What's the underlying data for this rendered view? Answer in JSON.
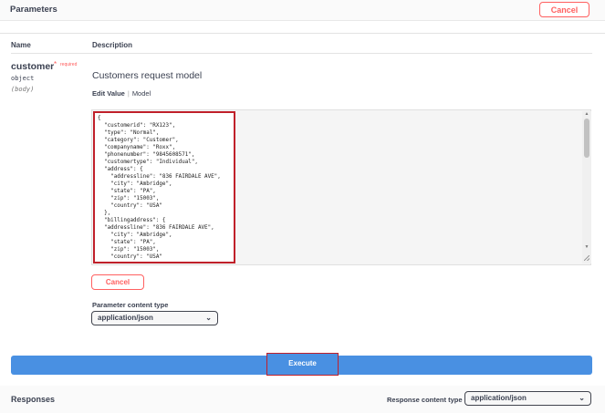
{
  "header": {
    "title": "Parameters",
    "cancel_label": "Cancel"
  },
  "columns": {
    "name": "Name",
    "description": "Description"
  },
  "parameter": {
    "name": "customer",
    "required_mark": "*",
    "required_label": "required",
    "type": "object",
    "location": "(body)",
    "description": "Customers request model",
    "tabs": {
      "edit_value": "Edit Value",
      "separator": "|",
      "model": "Model"
    },
    "body_json": "{\n  \"customerid\": \"RX123\",\n  \"type\": \"Normal\",\n  \"category\": \"Customer\",\n  \"companyname\": \"Roxx\",\n  \"phonenumber\": \"9845608571\",\n  \"customertype\": \"Individual\",\n  \"address\": {\n    \"addressline\": \"836 FAIRDALE AVE\",\n    \"city\": \"Ambridge\",\n    \"state\": \"PA\",\n    \"zip\": \"15003\",\n    \"country\": \"USA\"\n  },\n  \"billingaddress\": {\n  \"addressline\": \"836 FAIRDALE AVE\",\n    \"city\": \"Ambridge\",\n    \"state\": \"PA\",\n    \"zip\": \"15003\",\n    \"country\": \"USA\"\n  },"
  },
  "editor": {
    "cancel_label": "Cancel"
  },
  "content_type": {
    "label": "Parameter content type",
    "selected": "application/json"
  },
  "execute": {
    "label": "Execute"
  },
  "responses": {
    "title": "Responses",
    "content_type_label": "Response content type",
    "selected": "application/json"
  },
  "icons": {
    "dropdown": "chevron-down-icon",
    "scroll_up": "arrow-up-icon",
    "scroll_down": "arrow-down-icon"
  },
  "colors": {
    "cancel": "#ff6060",
    "execute": "#4990e2",
    "highlight": "#c0202a"
  }
}
